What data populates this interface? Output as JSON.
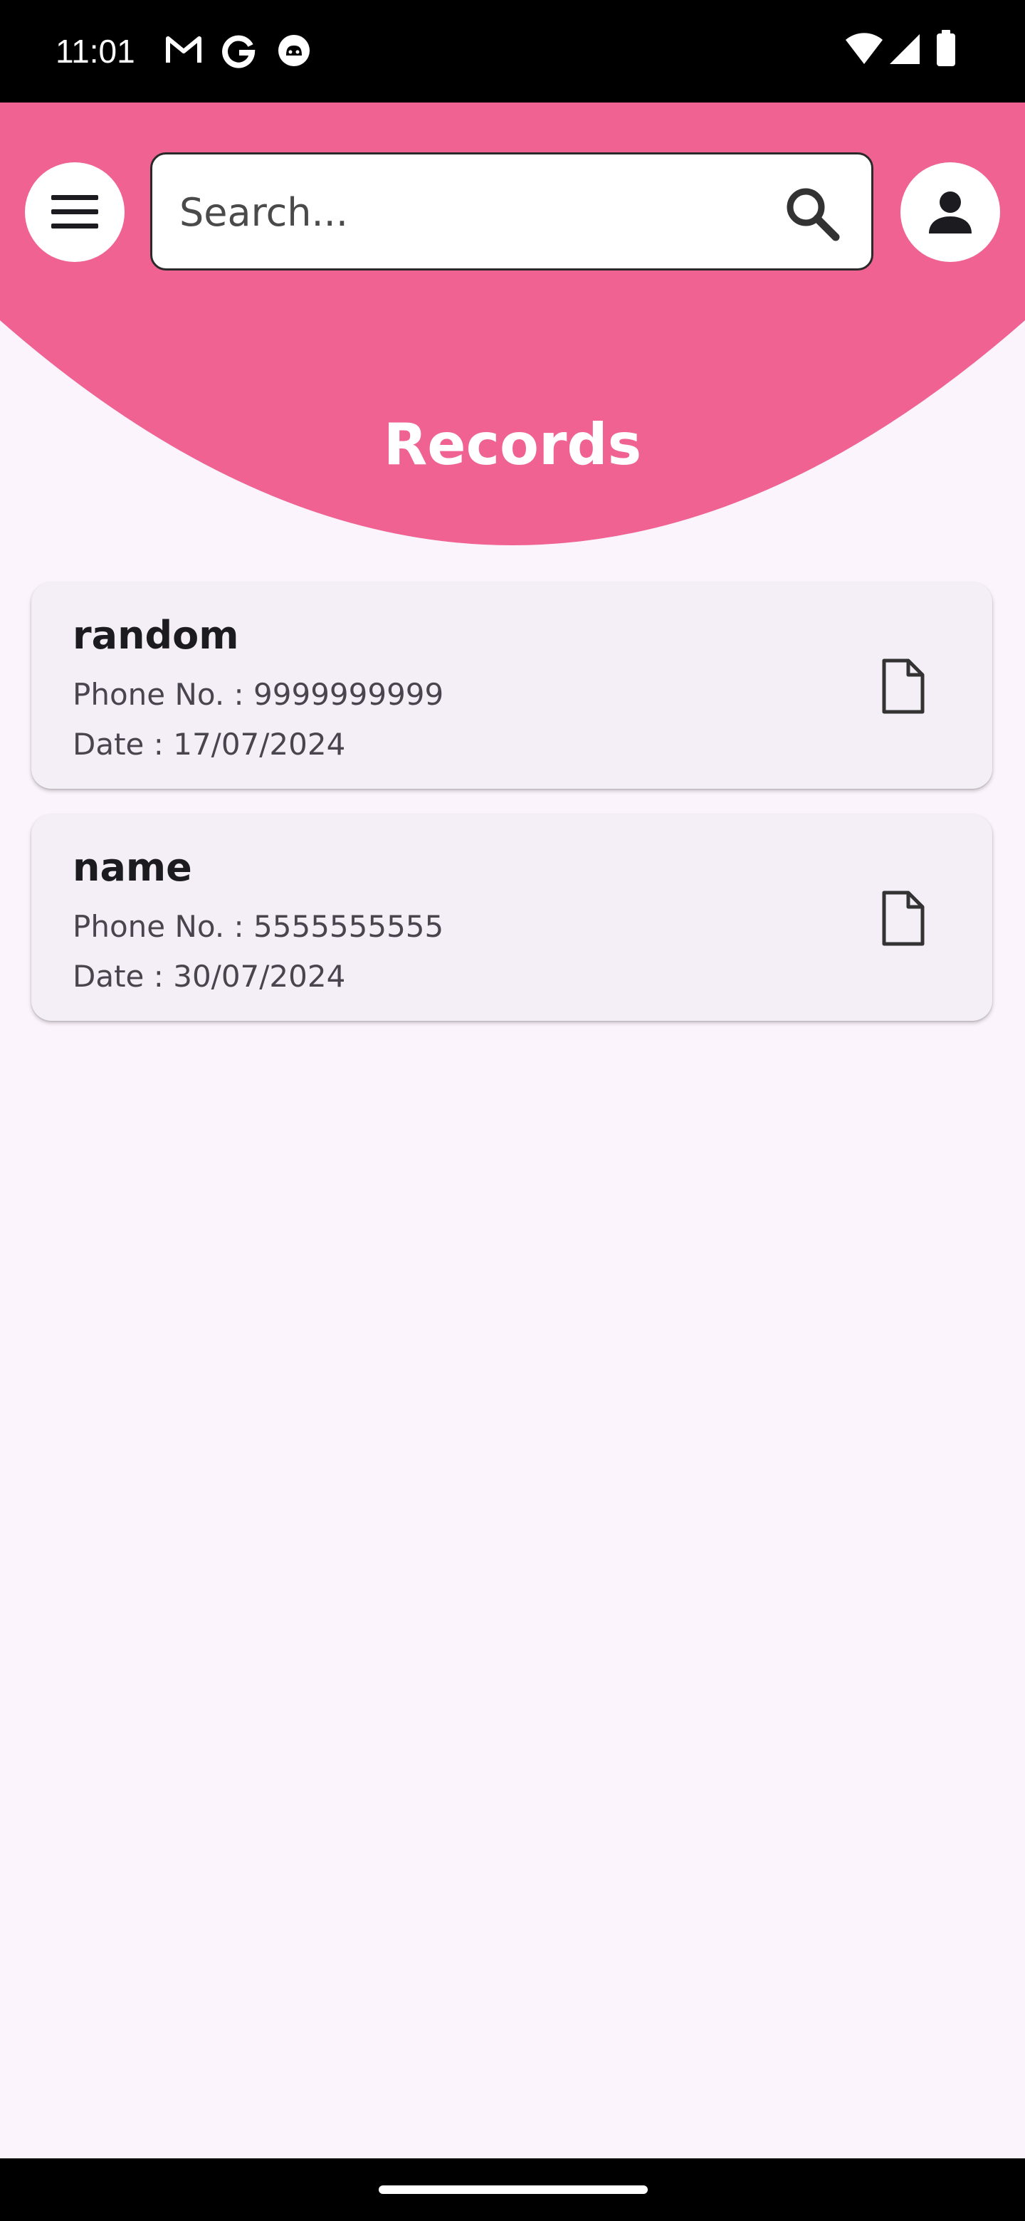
{
  "status_bar": {
    "time": "11:01",
    "left_icons": [
      "gmail-icon",
      "google-icon",
      "github-icon"
    ],
    "right_icons": [
      "wifi-icon",
      "signal-icon",
      "battery-icon"
    ]
  },
  "header": {
    "background_color": "#f06292",
    "menu_icon": "hamburger-menu-icon",
    "profile_icon": "person-icon",
    "search": {
      "placeholder": "Search...",
      "value": "",
      "icon": "search-icon"
    },
    "title": "Records"
  },
  "records": [
    {
      "name": "random",
      "phone": "Phone No. : 9999999999",
      "date": "Date : 17/07/2024",
      "icon": "file-icon"
    },
    {
      "name": "name",
      "phone": "Phone No. : 5555555555",
      "date": "Date : 30/07/2024",
      "icon": "file-icon"
    }
  ],
  "colors": {
    "accent": "#f06292",
    "page_background": "#fcf4fc",
    "card_background": "#f4eff6"
  }
}
